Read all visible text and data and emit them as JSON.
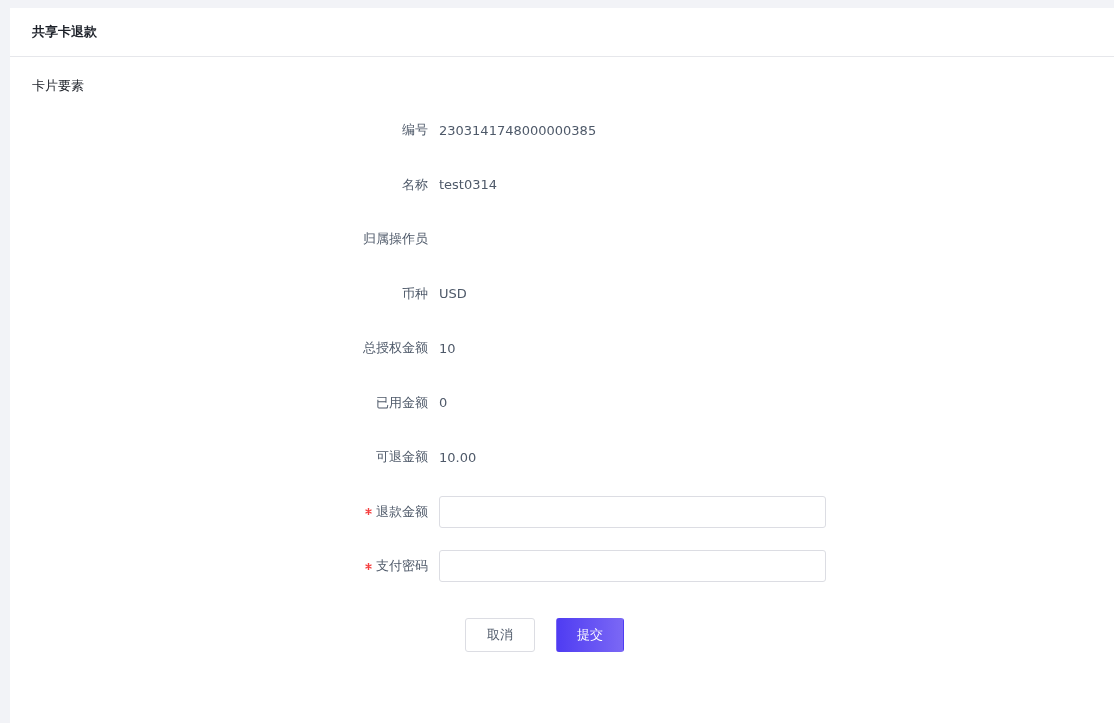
{
  "header": {
    "title": "共享卡退款"
  },
  "section": {
    "title": "卡片要素"
  },
  "fields": [
    {
      "kind": "display",
      "label": "编号",
      "value": "2303141748000000385"
    },
    {
      "kind": "display",
      "label": "名称",
      "value": "test0314"
    },
    {
      "kind": "display",
      "label": "归属操作员"
    },
    {
      "kind": "display",
      "label": "币种",
      "value": "USD"
    },
    {
      "kind": "display",
      "label": "总授权金额",
      "value": "10"
    },
    {
      "kind": "display",
      "label": "已用金额",
      "value": "0"
    },
    {
      "kind": "display",
      "label": "可退金额",
      "value": "10.00"
    },
    {
      "kind": "input",
      "label": "退款金额",
      "required": true
    },
    {
      "kind": "input",
      "label": "支付密码",
      "required": true
    }
  ],
  "buttons": [
    {
      "kind": "secondary",
      "label": "取消"
    },
    {
      "kind": "primary",
      "label": "提交"
    }
  ]
}
